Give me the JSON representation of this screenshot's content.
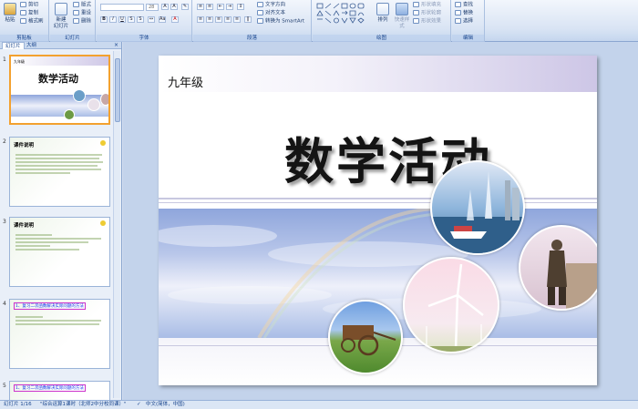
{
  "ribbon": {
    "clipboard": {
      "paste": "粘贴",
      "cut": "剪切",
      "copy": "复制",
      "format_painter": "格式刷",
      "label": "剪贴板"
    },
    "slides": {
      "new_slide": "新建\n幻灯片",
      "layout": "版式",
      "reset": "重设",
      "delete": "删除",
      "label": "幻灯片"
    },
    "font": {
      "font_size": "28",
      "label": "字体"
    },
    "paragraph": {
      "text_direction": "文字方向",
      "align_text": "对齐文本",
      "convert_smartart": "转换为 SmartArt",
      "label": "段落"
    },
    "drawing": {
      "arrange": "排列",
      "quick_styles": "快速样式",
      "shape_fill": "形状填充",
      "shape_outline": "形状轮廓",
      "shape_effects": "形状效果",
      "label": "绘图"
    },
    "editing": {
      "find": "查找",
      "replace": "替换",
      "select": "选择",
      "label": "编辑"
    }
  },
  "panel": {
    "tabs": [
      "幻灯片",
      "大纲"
    ],
    "thumbs": [
      {
        "num": "1",
        "title": "数学活动",
        "subtitle": "九年级"
      },
      {
        "num": "2",
        "title": "课件说明"
      },
      {
        "num": "3",
        "title": "课件说明"
      },
      {
        "num": "4",
        "title": "1、复习二次函数解决实际问题的方法"
      },
      {
        "num": "5",
        "title": "1、复习二次函数解决实际问题的方法"
      }
    ]
  },
  "slide": {
    "grade": "九年级",
    "title": "数学活动"
  },
  "statusbar": {
    "slide_info": "幻灯片 1/16",
    "theme": "\"综合运算1课时（北师2中分校同课）\"",
    "language": "中文(简体，中国)"
  },
  "colors": {
    "ribbon": "#d9e4f4",
    "selected_thumb": "#f3a12f",
    "stage": "#c3d3eb"
  }
}
